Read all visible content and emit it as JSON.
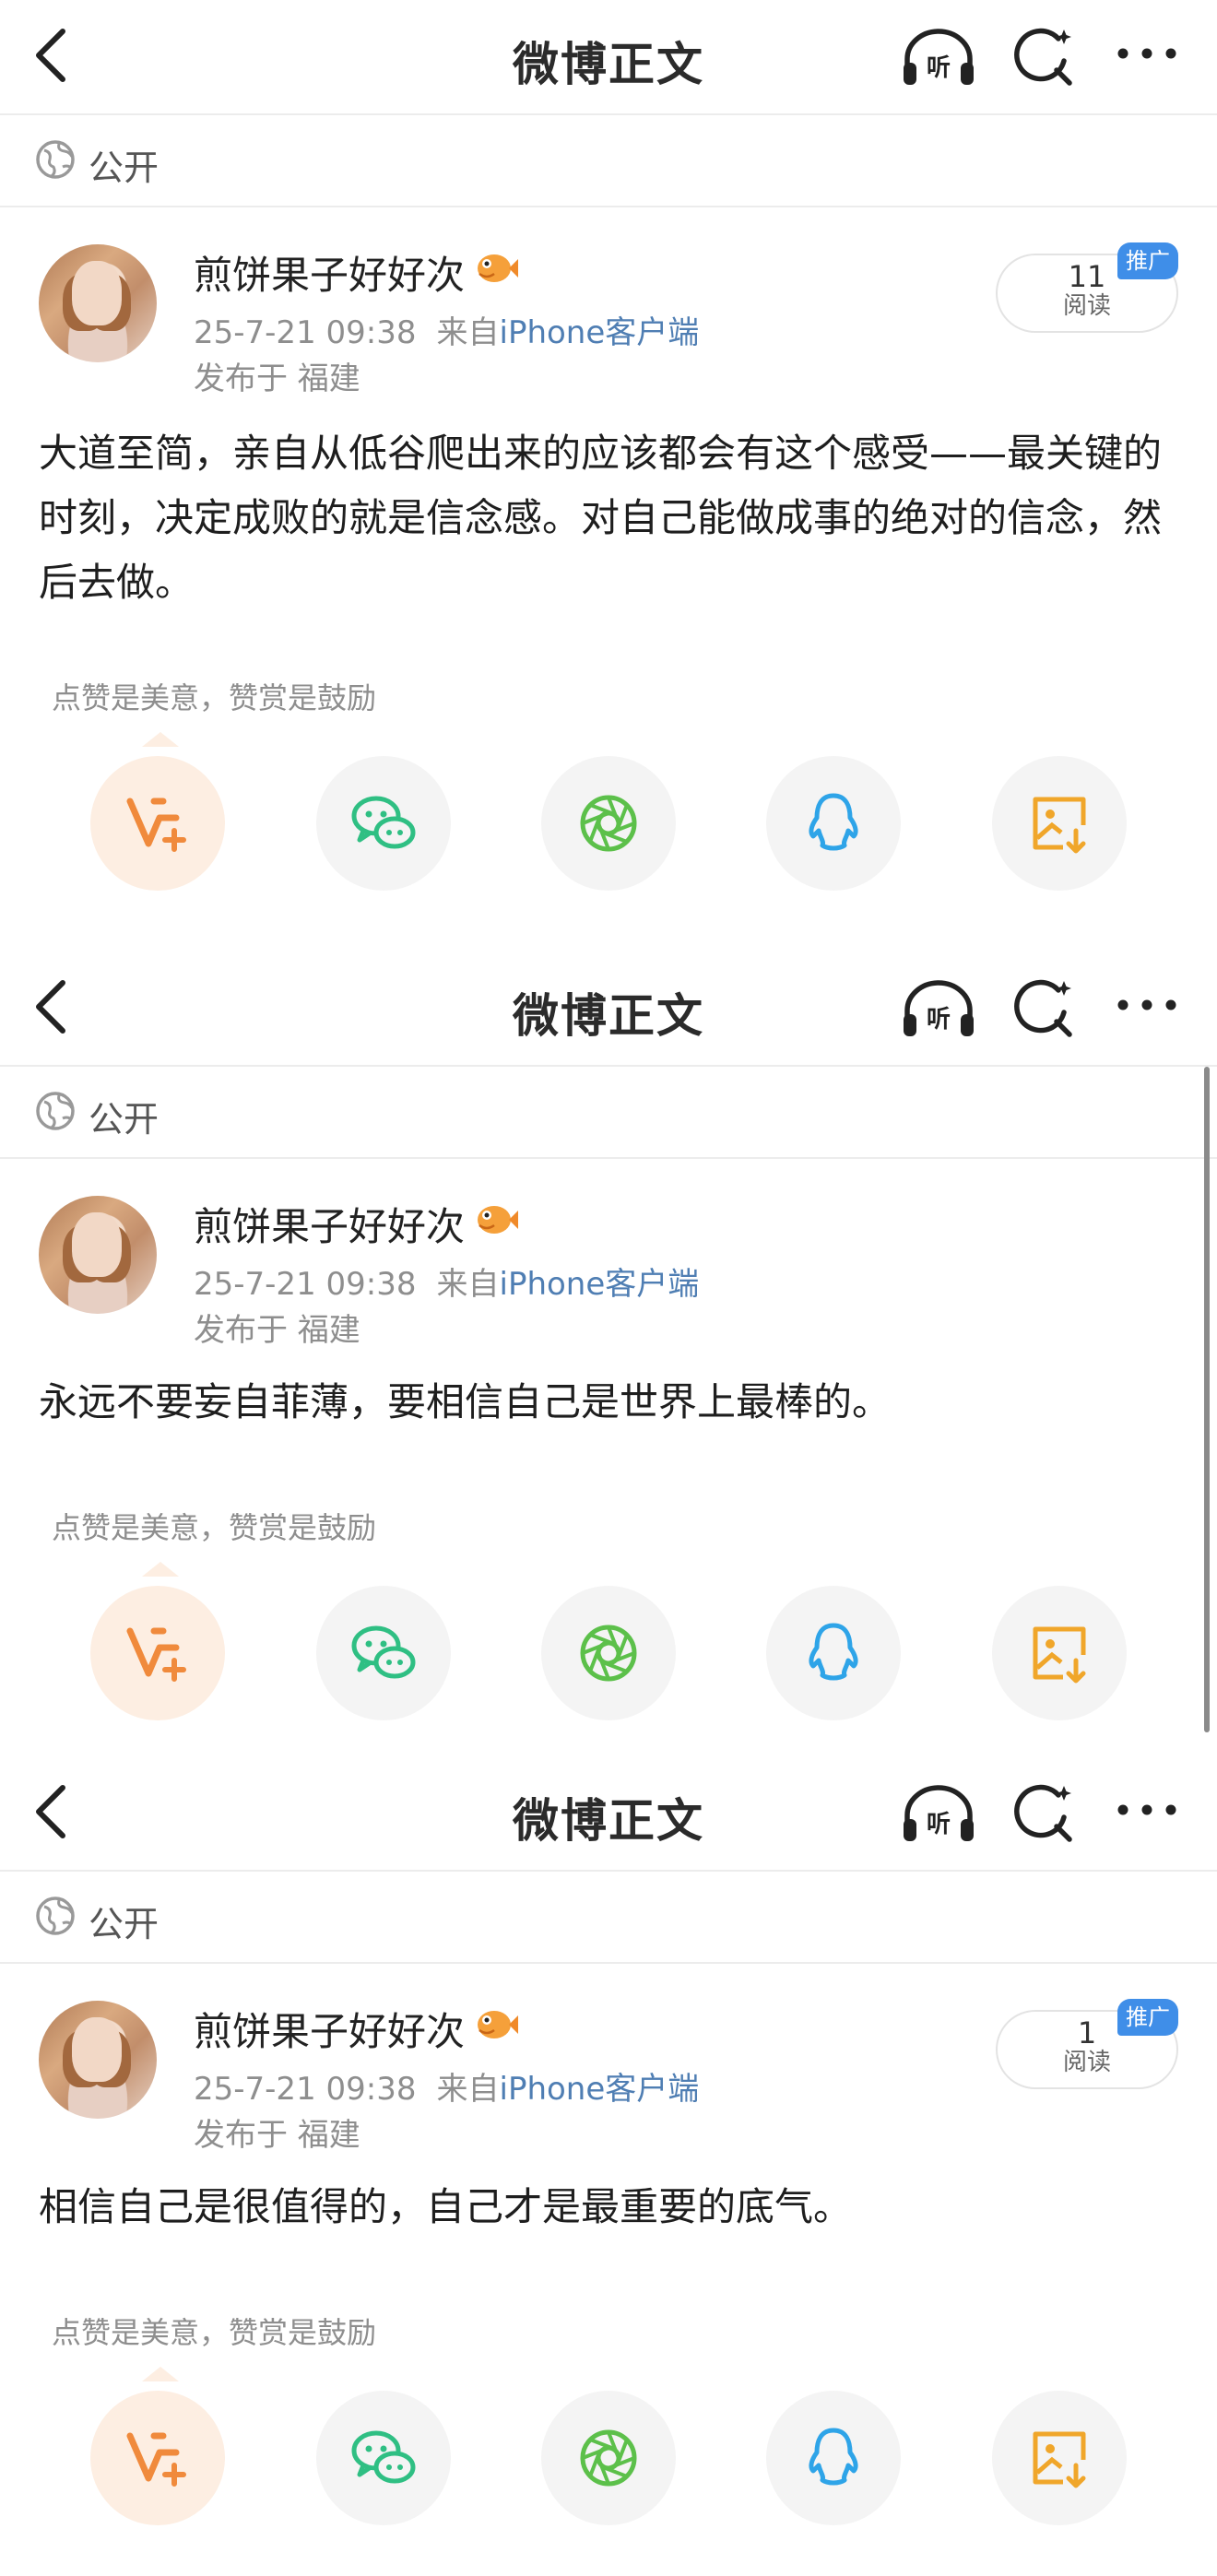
{
  "nav": {
    "title": "微博正文",
    "listen_label": "听"
  },
  "visibility": "公开",
  "posts": [
    {
      "username": "煎饼果子好好次",
      "date": "25-7-21 09:38",
      "from_label": "来自",
      "source": "iPhone客户端",
      "location": "发布于 福建",
      "reads": {
        "count": "11",
        "label": "阅读",
        "badge": "推广"
      },
      "content": "大道至简，亲自从低谷爬出来的应该都会有这个感受——最关键的时刻，决定成败的就是信念感。对自己能做成事的绝对的信念，然后去做。",
      "reward_hint": "点赞是美意，赞赏是鼓励"
    },
    {
      "username": "煎饼果子好好次",
      "date": "25-7-21 09:38",
      "from_label": "来自",
      "source": "iPhone客户端",
      "location": "发布于 福建",
      "content": "永远不要妄自菲薄，要相信自己是世界上最棒的。",
      "reward_hint": "点赞是美意，赞赏是鼓励"
    },
    {
      "username": "煎饼果子好好次",
      "date": "25-7-21 09:38",
      "from_label": "来自",
      "source": "iPhone客户端",
      "location": "发布于 福建",
      "reads": {
        "count": "1",
        "label": "阅读",
        "badge": "推广"
      },
      "content": "相信自己是很值得的，自己才是最重要的底气。",
      "reward_hint": "点赞是美意，赞赏是鼓励"
    }
  ],
  "share_icons": [
    "vip-reward-icon",
    "wechat-icon",
    "moments-icon",
    "qq-icon",
    "save-image-icon"
  ],
  "colors": {
    "link": "#4f7eb3",
    "promo": "#3f8ee8",
    "vip": "#f08a3c",
    "wechat": "#2fbf83",
    "moments": "#5cc04a",
    "qq": "#2ea4e8",
    "save": "#f0a62a"
  }
}
